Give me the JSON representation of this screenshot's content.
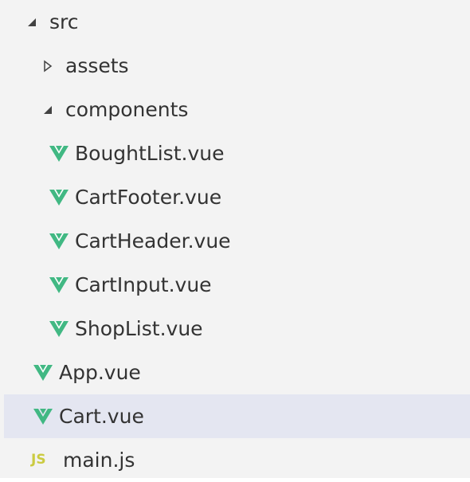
{
  "tree": {
    "items": [
      {
        "label": "src",
        "type": "folder",
        "expanded": true,
        "icon": "chevron-down-icon"
      },
      {
        "label": "assets",
        "type": "folder",
        "expanded": false,
        "icon": "chevron-right-icon"
      },
      {
        "label": "components",
        "type": "folder",
        "expanded": true,
        "icon": "chevron-down-icon"
      },
      {
        "label": "BoughtList.vue",
        "type": "file",
        "icon": "vue-icon"
      },
      {
        "label": "CartFooter.vue",
        "type": "file",
        "icon": "vue-icon"
      },
      {
        "label": "CartHeader.vue",
        "type": "file",
        "icon": "vue-icon"
      },
      {
        "label": "CartInput.vue",
        "type": "file",
        "icon": "vue-icon"
      },
      {
        "label": "ShopList.vue",
        "type": "file",
        "icon": "vue-icon"
      },
      {
        "label": "App.vue",
        "type": "file",
        "icon": "vue-icon"
      },
      {
        "label": "Cart.vue",
        "type": "file",
        "icon": "vue-icon",
        "selected": true
      },
      {
        "label": "main.js",
        "type": "file",
        "icon": "js-icon",
        "icon_text": "JS"
      }
    ]
  },
  "colors": {
    "background": "#f3f3f3",
    "selection": "#e4e6f1",
    "vue_green": "#41b883",
    "js_yellow": "#cbcb41",
    "text": "#333333"
  }
}
